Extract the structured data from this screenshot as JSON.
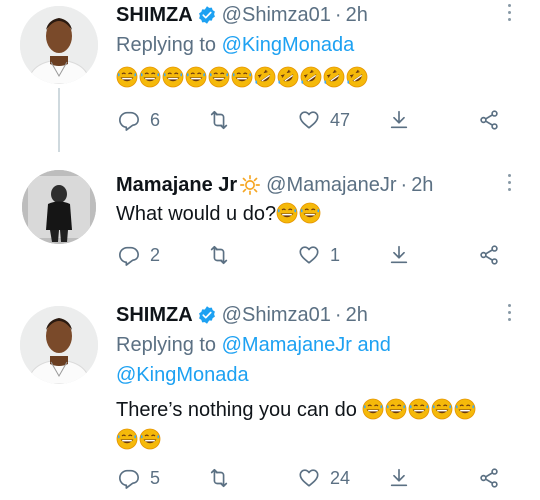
{
  "tweets": [
    {
      "name": "SHIMZA",
      "handle": "@Shimza01",
      "dot": "·",
      "time": "2h",
      "replying_prefix": "Replying to",
      "replying_to": "@KingMonada",
      "text": "",
      "emoji": [
        "grinning-sweat",
        "grinning-sweat",
        "grinning-sweat",
        "grinning-sweat",
        "grinning-sweat",
        "grinning-sweat",
        "rofl",
        "rofl",
        "rofl",
        "rofl",
        "rofl"
      ],
      "replies": "6",
      "retweets": "",
      "likes": "47"
    },
    {
      "name": "Mamajane Jr",
      "handle": "@MamajaneJr",
      "dot": "·",
      "time": "2h",
      "text": "What would u do?",
      "emoji": [
        "grinning-sweat",
        "grinning-sweat"
      ],
      "replies": "2",
      "retweets": "",
      "likes": "1"
    },
    {
      "name": "SHIMZA",
      "handle": "@Shimza01",
      "dot": "·",
      "time": "2h",
      "replying_prefix": "Replying to",
      "replying_to": "@MamajaneJr and",
      "replying_to_2": "@KingMonada",
      "text": "There’s nothing you can do",
      "emoji": [
        "grinning-sweat",
        "grinning-sweat",
        "grinning-sweat",
        "grinning-sweat",
        "grinning-sweat"
      ],
      "emoji_line2": [
        "grinning-sweat",
        "grinning-sweat"
      ],
      "replies": "5",
      "retweets": "",
      "likes": "24"
    }
  ],
  "colors": {
    "verified": "#1da1f2",
    "link": "#1da1f2",
    "muted": "#5b7083"
  }
}
